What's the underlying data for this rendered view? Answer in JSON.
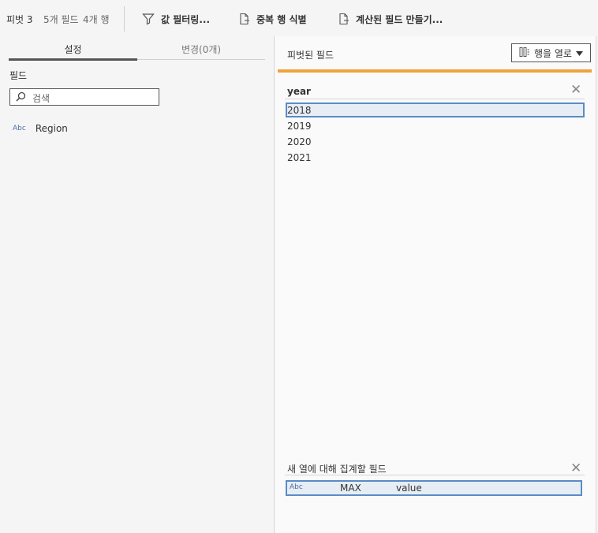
{
  "toolbar": {
    "step_name": "피벗 3",
    "field_count": "5개 필드",
    "row_count": "4개 행",
    "filter_label": "값 필터링...",
    "dedupe_label": "중복 행 식별",
    "calc_label": "계산된 필드 만들기..."
  },
  "left": {
    "tabs": [
      {
        "label": "설정",
        "active": true
      },
      {
        "label": "변경(0개)",
        "active": false
      }
    ],
    "fields_label": "필드",
    "search": {
      "placeholder": "검색",
      "value": ""
    },
    "fields": [
      {
        "type_badge": "Abc",
        "name": "Region"
      }
    ]
  },
  "right": {
    "title": "피벗된 필드",
    "pivot_direction_label": "행을 열로",
    "accent_color": "#f0a23c",
    "pivot_field": {
      "name": "year",
      "values": [
        "2018",
        "2019",
        "2020",
        "2021"
      ],
      "selected_index": 0
    },
    "aggregate": {
      "header": "새 열에 대해 집계할 필드",
      "rows": [
        {
          "type_badge": "Abc",
          "function": "MAX",
          "field": "value"
        }
      ]
    }
  }
}
